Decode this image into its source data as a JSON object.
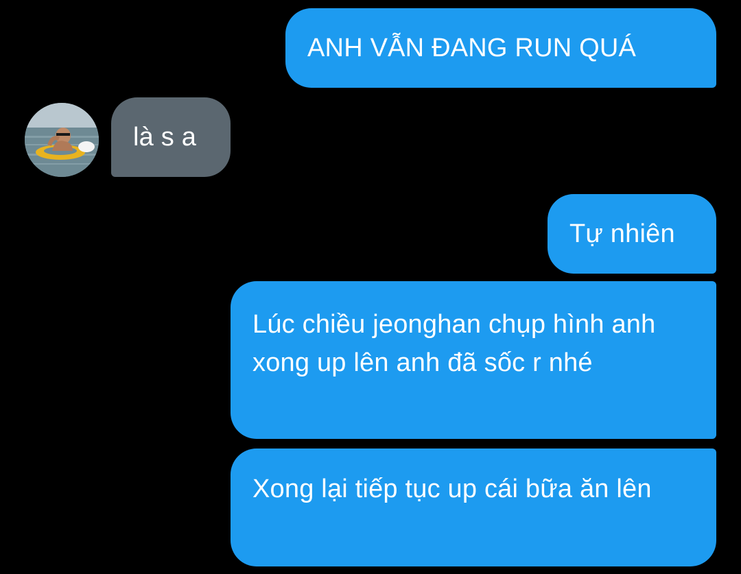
{
  "conversation": {
    "messages": [
      {
        "direction": "outgoing",
        "text": "ANH VẪN ĐANG RUN QUÁ"
      },
      {
        "direction": "incoming",
        "text": "là s a"
      },
      {
        "direction": "outgoing",
        "text": "Tự nhiên"
      },
      {
        "direction": "outgoing",
        "text": "Lúc chiều jeonghan chụp hình anh xong up lên anh đã sốc r nhé"
      },
      {
        "direction": "outgoing",
        "text": "Xong lại tiếp tục up cái bữa ăn lên"
      }
    ]
  },
  "colors": {
    "background": "#000000",
    "outgoing_bubble": "#1d9bf0",
    "incoming_bubble": "#5b6770",
    "text": "#ffffff"
  },
  "icons": {
    "avatar": "user-avatar-photo"
  }
}
